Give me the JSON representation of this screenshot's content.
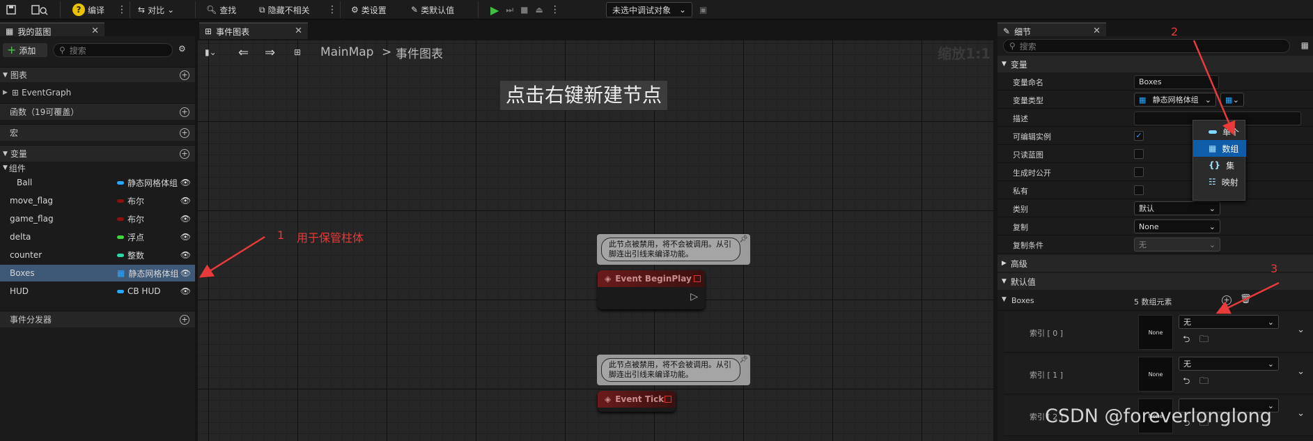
{
  "toolbar": {
    "compile": "编译",
    "diff": "对比",
    "find": "查找",
    "hide_unrelated": "隐藏不相关",
    "class_settings": "类设置",
    "class_defaults": "类默认值",
    "debug_target": "未选中调试对象"
  },
  "my_blueprint": {
    "tab": "我的蓝图",
    "add": "添加",
    "search_placeholder": "搜索",
    "sections": {
      "graphs": "图表",
      "event_graph": "EventGraph",
      "functions": "函数（19可覆盖）",
      "macros": "宏",
      "variables": "变量",
      "components": "组件",
      "dispatchers": "事件分发器"
    },
    "variables": [
      {
        "name": "Ball",
        "type": "静态网格体组",
        "color": "#29a8ff",
        "kind": "pill"
      },
      {
        "name": "move_flag",
        "type": "布尔",
        "color": "#8c1010",
        "kind": "pill"
      },
      {
        "name": "game_flag",
        "type": "布尔",
        "color": "#8c1010",
        "kind": "pill"
      },
      {
        "name": "delta",
        "type": "浮点",
        "color": "#3fd63f",
        "kind": "pill"
      },
      {
        "name": "counter",
        "type": "整数",
        "color": "#2fd6a8",
        "kind": "pill"
      },
      {
        "name": "Boxes",
        "type": "静态网格体组",
        "color": "#29a8ff",
        "kind": "grid",
        "selected": true
      },
      {
        "name": "HUD",
        "type": "CB HUD",
        "color": "#29a8ff",
        "kind": "pill"
      }
    ]
  },
  "graph": {
    "tab": "事件图表",
    "breadcrumb_root": "MainMap",
    "breadcrumb_sep": ">",
    "breadcrumb_leaf": "事件图表",
    "zoom": "缩放1:1",
    "hint": "点击右键新建节点",
    "comment_text": "此节点被禁用，将不会被调用。从引脚连出引线来编译功能。",
    "node_begin": "Event BeginPlay",
    "node_tick": "Event Tick"
  },
  "details": {
    "tab": "细节",
    "search_placeholder": "搜索",
    "section_variable": "变量",
    "rows": {
      "var_name_label": "变量命名",
      "var_name_value": "Boxes",
      "var_type_label": "变量类型",
      "var_type_value": "静态网格体组",
      "description_label": "描述",
      "instance_editable_label": "可编辑实例",
      "readonly_label": "只读蓝图",
      "expose_spawn_label": "生成时公开",
      "private_label": "私有",
      "category_label": "类别",
      "category_value": "默认",
      "replication_label": "复制",
      "replication_value": "None",
      "rep_condition_label": "复制条件",
      "rep_condition_value": "无"
    },
    "section_advanced": "高级",
    "section_default": "默认值",
    "boxes_label": "Boxes",
    "boxes_count": "5 数组元素",
    "index_rows": [
      {
        "label": "索引 [ 0 ]",
        "thumb": "None",
        "value": "无"
      },
      {
        "label": "索引 [ 1 ]",
        "thumb": "None",
        "value": "无"
      },
      {
        "label": "索引 [ 2 ]",
        "thumb": "None",
        "value": ""
      }
    ],
    "type_menu": [
      "单个",
      "数组",
      "集",
      "映射"
    ]
  },
  "annotations": {
    "n1": "1",
    "n1_text": "用于保管柱体",
    "n2": "2",
    "n3": "3"
  },
  "watermark": "CSDN @foreverlonglong"
}
